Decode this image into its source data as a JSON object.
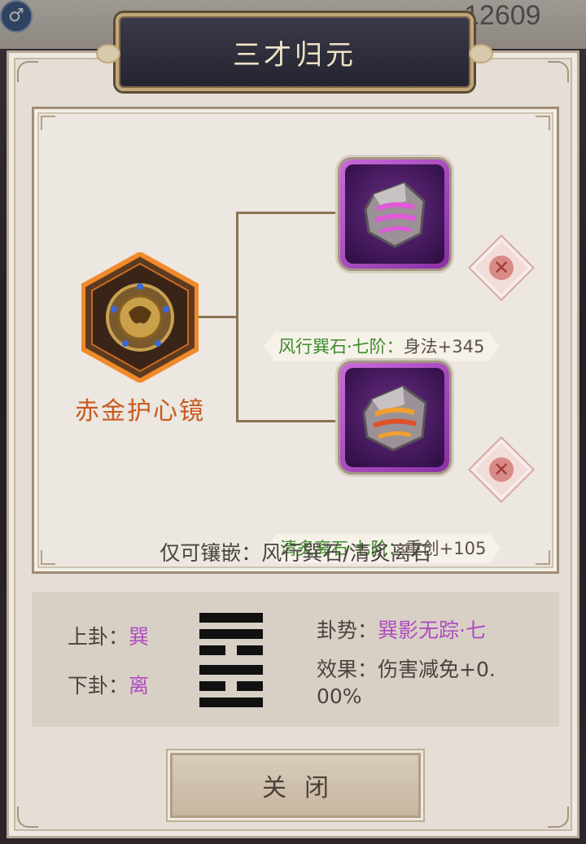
{
  "background": {
    "gender_icon": "male-symbol-icon",
    "gender_glyph": "♂",
    "number": "12609"
  },
  "dialog": {
    "title": "三才归元",
    "main_item": {
      "name": "赤金护心镜",
      "icon": "bronze-mirror-icon",
      "frame_color": "#e8872a"
    },
    "gems": [
      {
        "name": "风行巽石·七阶：",
        "stat": "身法+345",
        "icon": "purple-rune-stone-icon",
        "glow_color": "#e05ad8"
      },
      {
        "name": "清炙离石·七阶：",
        "stat": "重创+105",
        "icon": "fire-rune-stone-icon",
        "glow_color": "#f0a030"
      }
    ],
    "remove_glyph": "✕",
    "inlay_hint": "仅可镶嵌：风行巽石/清炙离石",
    "trigram": {
      "upper_label": "上卦：",
      "upper_value": "巽",
      "lower_label": "下卦：",
      "lower_value": "离",
      "trend_label": "卦势：",
      "trend_value": "巽影无踪·七",
      "effect_label": "效果：",
      "effect_value_line1": "伤害减免+0.",
      "effect_value_line2": "00%"
    },
    "close_label": "关闭"
  },
  "colors": {
    "gem_name": "#3d8a2a",
    "item_name": "#c85a1e",
    "trigram_value": "#b04bc0"
  }
}
